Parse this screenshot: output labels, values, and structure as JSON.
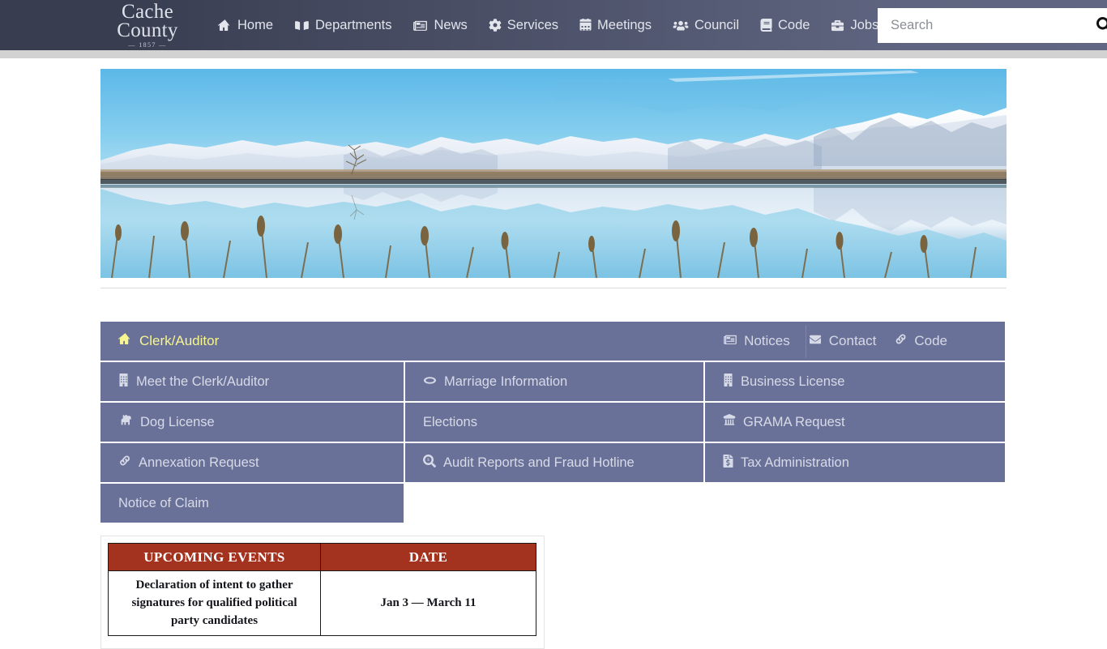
{
  "site": {
    "brand_line1": "Cache",
    "brand_line2": "County",
    "brand_year": "— 1857 —"
  },
  "nav": {
    "items": [
      {
        "label": "Home",
        "icon": "home-icon"
      },
      {
        "label": "Departments",
        "icon": "book-open-icon"
      },
      {
        "label": "News",
        "icon": "newspaper-icon"
      },
      {
        "label": "Services",
        "icon": "gear-icon"
      },
      {
        "label": "Meetings",
        "icon": "calendar-icon"
      },
      {
        "label": "Council",
        "icon": "users-icon"
      },
      {
        "label": "Code",
        "icon": "book-icon"
      },
      {
        "label": "Jobs",
        "icon": "briefcase-icon"
      }
    ]
  },
  "search": {
    "placeholder": "Search",
    "value": "",
    "icon": "search-icon"
  },
  "hero": {
    "alt": "Snow-capped mountain range reflected in still water with cattails in foreground"
  },
  "department": {
    "title": "Clerk/Auditor",
    "title_icon": "home-icon",
    "links": [
      {
        "label": "Notices",
        "icon": "newspaper-icon"
      },
      {
        "label": "Contact",
        "icon": "envelope-icon"
      },
      {
        "label": "Code",
        "icon": "link-icon"
      }
    ],
    "tiles": [
      [
        {
          "label": "Meet the Clerk/Auditor",
          "icon": "building-icon"
        },
        {
          "label": "Marriage Information",
          "icon": "ring-icon"
        },
        {
          "label": "Business License",
          "icon": "building-icon"
        }
      ],
      [
        {
          "label": "Dog License",
          "icon": "dog-icon"
        },
        {
          "label": "Elections",
          "icon": ""
        },
        {
          "label": "GRAMA Request",
          "icon": "bank-icon"
        }
      ],
      [
        {
          "label": "Annexation Request",
          "icon": "link-icon"
        },
        {
          "label": "Audit Reports and Fraud Hotline",
          "icon": "search-dollar-icon"
        },
        {
          "label": "Tax Administration",
          "icon": "file-invoice-dollar-icon"
        }
      ],
      [
        {
          "label": "Notice of Claim",
          "icon": ""
        },
        {
          "label": "",
          "icon": ""
        },
        {
          "label": "",
          "icon": ""
        }
      ]
    ]
  },
  "events_table": {
    "headers": [
      "UPCOMING EVENTS",
      "DATE"
    ],
    "rows": [
      {
        "event": "Declaration of intent to gather signatures for qualified political party candidates",
        "date": "Jan 3 — March 11"
      }
    ]
  },
  "colors": {
    "nav_dark": "#383d50",
    "nav_light": "#616782",
    "gray_strip": "#d2d2d2",
    "tile_bg": "#6a7198",
    "tile_text": "#d7dae7",
    "dept_title_text": "#f6f58f",
    "table_header_bg": "#a3321f",
    "table_header_text": "#ffffff"
  }
}
